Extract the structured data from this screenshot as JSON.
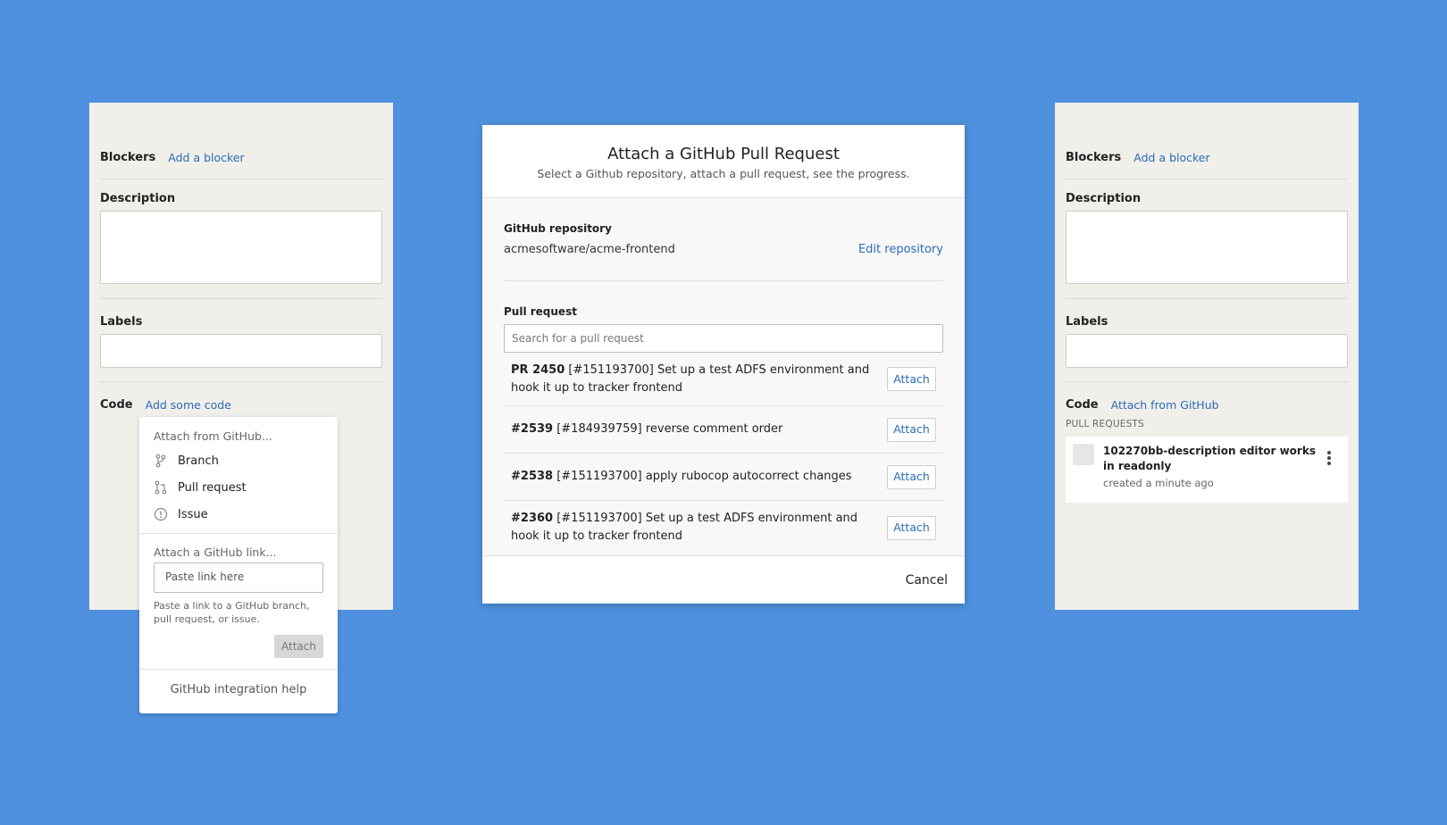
{
  "left_panel": {
    "blockers_label": "Blockers",
    "add_blocker": "Add a blocker",
    "description_label": "Description",
    "labels_label": "Labels",
    "code_label": "Code",
    "add_code": "Add some code"
  },
  "popover": {
    "attach_from_heading": "Attach from GitHub...",
    "items": [
      {
        "label": "Branch",
        "icon": "branch-icon"
      },
      {
        "label": "Pull request",
        "icon": "pull-request-icon"
      },
      {
        "label": "Issue",
        "icon": "issue-icon"
      }
    ],
    "attach_link_heading": "Attach a GitHub link...",
    "link_placeholder": "Paste link here",
    "help_text": "Paste a link to a GitHub branch, pull request, or issue.",
    "attach_button": "Attach",
    "footer_link": "GitHub integration help"
  },
  "modal": {
    "title": "Attach a GitHub Pull Request",
    "subtitle": "Select a Github repository, attach a pull request, see the progress.",
    "repo_label": "GitHub repository",
    "repo_name": "acmesoftware/acme-frontend",
    "edit_repo": "Edit repository",
    "pr_label": "Pull request",
    "search_placeholder": "Search for a pull request",
    "pull_requests": [
      {
        "id": "PR 2450",
        "text": "[#151193700] Set up a test ADFS environment and hook it up to tracker frontend",
        "button": "Attach"
      },
      {
        "id": "#2539",
        "text": "[#184939759] reverse comment order",
        "button": "Attach"
      },
      {
        "id": "#2538",
        "text": "[#151193700] apply rubocop autocorrect changes",
        "button": "Attach"
      },
      {
        "id": "#2360",
        "text": "[#151193700] Set up a test ADFS environment and hook it up to tracker frontend",
        "button": "Attach"
      }
    ],
    "cancel": "Cancel"
  },
  "right_panel": {
    "blockers_label": "Blockers",
    "add_blocker": "Add a blocker",
    "description_label": "Description",
    "labels_label": "Labels",
    "code_label": "Code",
    "attach_from_github": "Attach from GitHub",
    "pull_requests_heading": "PULL REQUESTS",
    "attached_pr": {
      "title": "102270bb-description editor works in readonly",
      "meta": "created a minute ago"
    }
  },
  "colors": {
    "background": "#4f91de",
    "panel": "#f0efea",
    "link": "#2b6cb5"
  }
}
